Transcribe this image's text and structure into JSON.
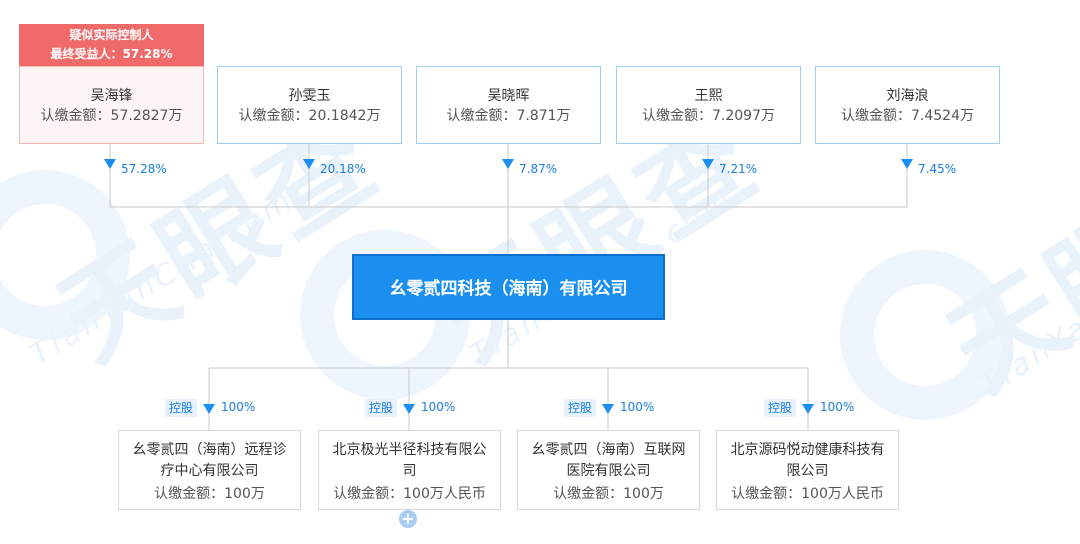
{
  "shareholders": [
    {
      "name": "吴海锋",
      "amount": "认缴金额：57.2827万",
      "pct": "57.28%"
    },
    {
      "name": "孙雯玉",
      "amount": "认缴金额：20.1842万",
      "pct": "20.18%"
    },
    {
      "name": "吴晓晖",
      "amount": "认缴金额：7.871万",
      "pct": "7.87%"
    },
    {
      "name": "王熙",
      "amount": "认缴金额：7.2097万",
      "pct": "7.21%"
    },
    {
      "name": "刘海浪",
      "amount": "认缴金额：7.4524万",
      "pct": "7.45%"
    }
  ],
  "controller_tag": {
    "line1": "疑似实际控制人",
    "line2": "最终受益人：57.28%"
  },
  "company": {
    "name": "幺零贰四科技（海南）有限公司"
  },
  "subsidiaries": [
    {
      "control": "控股",
      "pct": "100%",
      "name": "幺零贰四（海南）远程诊疗中心有限公司",
      "amount": "认缴金额：100万"
    },
    {
      "control": "控股",
      "pct": "100%",
      "name": "北京极光半径科技有限公司",
      "amount": "认缴金额：100万人民币"
    },
    {
      "control": "控股",
      "pct": "100%",
      "name": "幺零贰四（海南）互联网医院有限公司",
      "amount": "认缴金额：100万"
    },
    {
      "control": "控股",
      "pct": "100%",
      "name": "北京源码悦动健康科技有限公司",
      "amount": "认缴金额：100万人民币"
    }
  ],
  "watermark": {
    "text": "天眼查",
    "sub": "TianYanCha.com"
  },
  "expand_symbol": "+",
  "colors": {
    "primary": "#1a8ff0",
    "controller_tag": "#f16a6a",
    "line": "#c9c9c9"
  }
}
